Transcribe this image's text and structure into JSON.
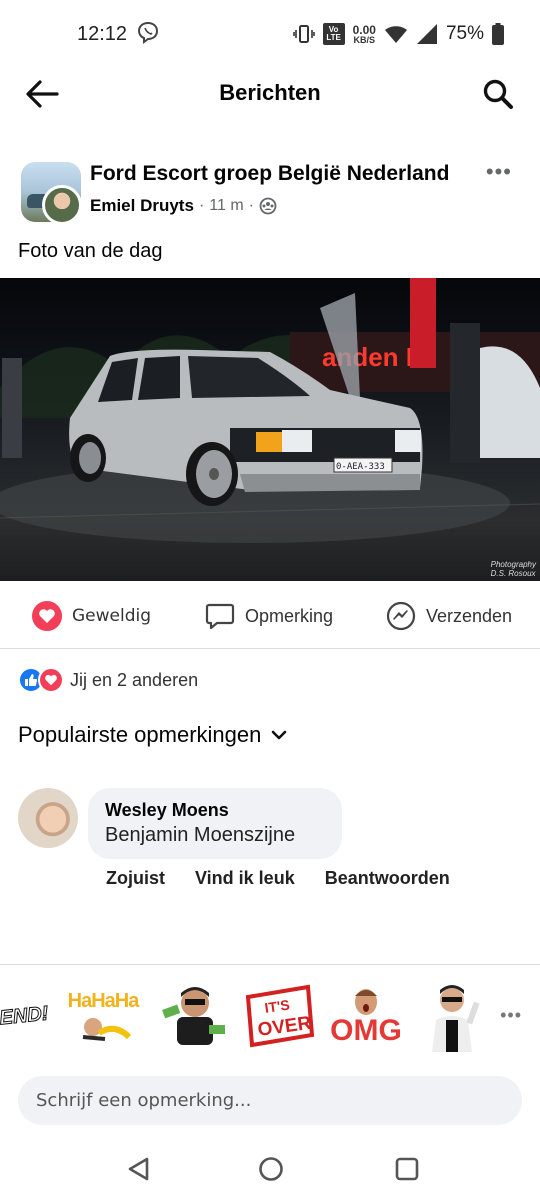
{
  "status_bar": {
    "time": "12:12",
    "network_speed_value": "0.00",
    "network_speed_unit": "KB/S",
    "lte_badge": "Vo LTE",
    "battery_percent": "75%"
  },
  "header": {
    "title": "Berichten",
    "back_icon": "arrow-left-icon",
    "search_icon": "search-icon"
  },
  "post": {
    "group_name": "Ford Escort groep België Nederland",
    "author": "Emiel Druyts",
    "separator": "·",
    "time_ago": "11 m",
    "audience_icon": "group-members-icon",
    "text": "Foto van de dag",
    "photo": {
      "description_icon": "car-photo",
      "plate": "0-AEA-333",
      "sign": "anden B",
      "watermark_line1": "Photography",
      "watermark_line2": "D.S. Rosoux"
    }
  },
  "actions": {
    "love_label": "Geweldig",
    "comment_label": "Opmerking",
    "share_label": "Verzenden"
  },
  "reactions": {
    "summary": "Jij en 2 anderen"
  },
  "comments": {
    "sort_label": "Populairste opmerkingen",
    "items": [
      {
        "author": "Wesley Moens",
        "text": "Benjamin Moenszijne",
        "time": "Zojuist",
        "like": "Vind ik leuk",
        "reply": "Beantwoorden"
      }
    ]
  },
  "stickers": {
    "items": [
      "END!",
      "HaHaHa",
      "money-sticker",
      "IT'S OVER",
      "OMG",
      "selfie-sticker"
    ],
    "end_text": "END!",
    "haha_text": "HaHaHa",
    "over_line1": "IT'S",
    "over_line2": "OVER",
    "omg_text": "OMG"
  },
  "composer": {
    "placeholder": "Schrijf een opmerking..."
  },
  "colors": {
    "facebook_blue": "#1877f2",
    "love_red": "#f33e58",
    "bubble_grey": "#f0f2f5",
    "meta_grey": "#65676b"
  }
}
